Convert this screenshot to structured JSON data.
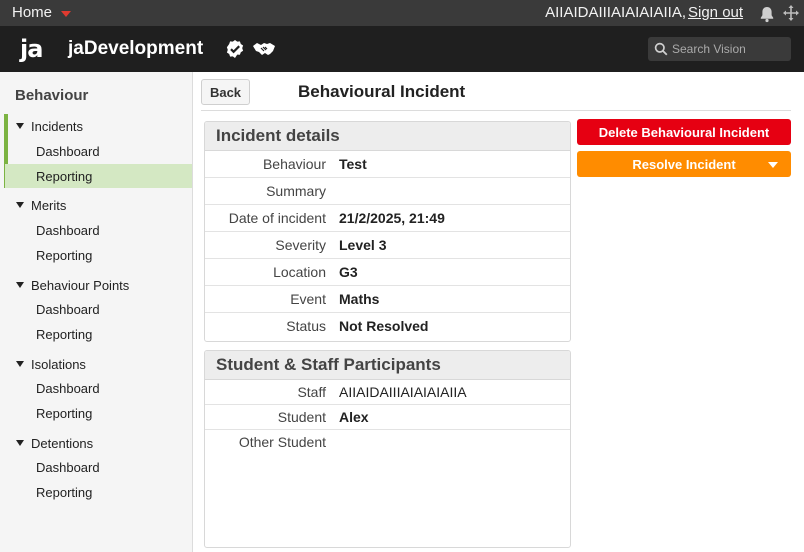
{
  "topbar": {
    "home_label": "Home",
    "user_name": "AIIAIDAIIIAIAIAIAIIA,",
    "signout_label": "Sign out",
    "bell_icon": "bell-icon",
    "move_icon": "move-arrows-icon"
  },
  "header": {
    "logo": "ja",
    "app_name": "jaDevelopment",
    "search_placeholder": "Search Vision"
  },
  "sidebar": {
    "title": "Behaviour",
    "sections": [
      {
        "label": "Incidents",
        "items": [
          {
            "label": "Dashboard"
          },
          {
            "label": "Reporting",
            "selected": true
          }
        ]
      },
      {
        "label": "Merits",
        "items": [
          {
            "label": "Dashboard"
          },
          {
            "label": "Reporting"
          }
        ]
      },
      {
        "label": "Behaviour Points",
        "items": [
          {
            "label": "Dashboard"
          },
          {
            "label": "Reporting"
          }
        ]
      },
      {
        "label": "Isolations",
        "items": [
          {
            "label": "Dashboard"
          },
          {
            "label": "Reporting"
          }
        ]
      },
      {
        "label": "Detentions",
        "items": [
          {
            "label": "Dashboard"
          },
          {
            "label": "Reporting"
          }
        ]
      }
    ]
  },
  "main": {
    "back_label": "Back",
    "page_title": "Behavioural Incident",
    "incident_details": {
      "heading": "Incident details",
      "rows": [
        {
          "key": "Behaviour",
          "value": "Test"
        },
        {
          "key": "Summary",
          "value": ""
        },
        {
          "key": "Date of incident",
          "value": "21/2/2025, 21:49"
        },
        {
          "key": "Severity",
          "value": "Level 3"
        },
        {
          "key": "Location",
          "value": "G3"
        },
        {
          "key": "Event",
          "value": "Maths"
        },
        {
          "key": "Status",
          "value": "Not Resolved"
        }
      ]
    },
    "participants": {
      "heading": "Student & Staff Participants",
      "rows": [
        {
          "key": "Staff",
          "value": "AIIAIDAIIIAIAIAIAIIA"
        },
        {
          "key": "Student",
          "value": "Alex"
        },
        {
          "key": "Other Student",
          "value": ""
        }
      ]
    },
    "actions": {
      "delete_label": "Delete Behavioural Incident",
      "resolve_label": "Resolve Incident"
    }
  },
  "colors": {
    "topbar_bg": "#3a3a3a",
    "header_bg": "#1f1f1f",
    "delete_red": "#e60012",
    "resolve_orange": "#ff8c00",
    "active_green": "#7cb342",
    "selected_bg": "#d4e8c3"
  }
}
